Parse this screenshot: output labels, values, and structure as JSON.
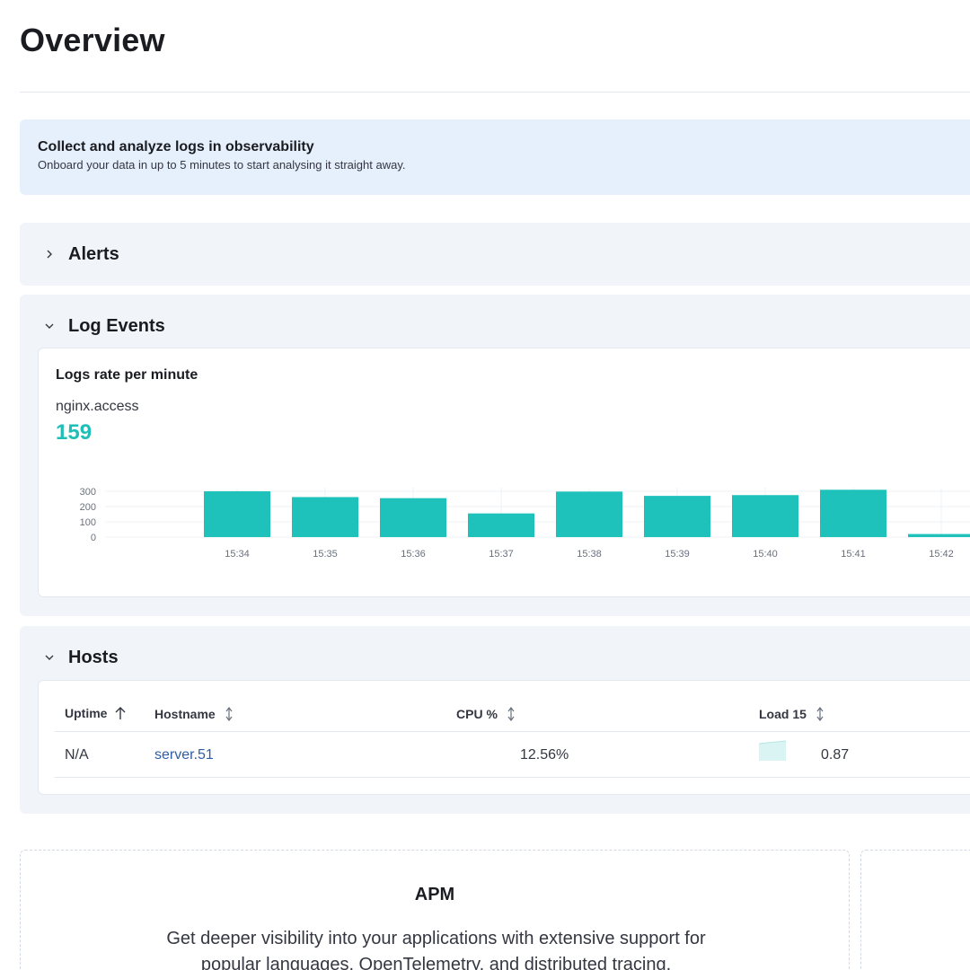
{
  "page": {
    "title": "Overview"
  },
  "callout": {
    "title": "Collect and analyze logs in observability",
    "text": "Onboard your data in up to 5 minutes to start analysing it straight away."
  },
  "sections": {
    "alerts": {
      "title": "Alerts",
      "expanded": false
    },
    "log_events": {
      "title": "Log Events",
      "expanded": true
    },
    "hosts": {
      "title": "Hosts",
      "expanded": true
    }
  },
  "logs_chart": {
    "title": "Logs rate per minute",
    "metric_label": "nginx.access",
    "metric_value": "159",
    "accent_color": "#1fc2bb"
  },
  "chart_data": {
    "type": "bar",
    "title": "Logs rate per minute",
    "categories": [
      "15:34",
      "15:35",
      "15:36",
      "15:37",
      "15:38",
      "15:39",
      "15:40",
      "15:41",
      "15:42"
    ],
    "series": [
      {
        "name": "nginx.access",
        "values": [
          300,
          262,
          255,
          155,
          298,
          270,
          275,
          310,
          20
        ]
      }
    ],
    "y_ticks": [
      0,
      100,
      200,
      300
    ],
    "ylim": [
      0,
      300
    ],
    "grid": true,
    "xlabel": "",
    "ylabel": ""
  },
  "hosts_table": {
    "columns": [
      {
        "label": "Uptime",
        "sort": "asc"
      },
      {
        "label": "Hostname",
        "sort": "none"
      },
      {
        "label": "CPU %",
        "sort": "none"
      },
      {
        "label": "Load 15",
        "sort": "none"
      }
    ],
    "rows": [
      {
        "uptime": "N/A",
        "hostname": "server.51",
        "cpu": "12.56%",
        "load15": "0.87"
      }
    ]
  },
  "cards": {
    "apm": {
      "title": "APM",
      "text": "Get deeper visibility into your applications with extensive support for popular languages, OpenTelemetry, and distributed tracing."
    }
  },
  "colors": {
    "accent": "#1fc2bb",
    "link": "#2d5ea6",
    "callout_bg": "#e6f0fc",
    "section_bg": "#f1f5fa"
  }
}
